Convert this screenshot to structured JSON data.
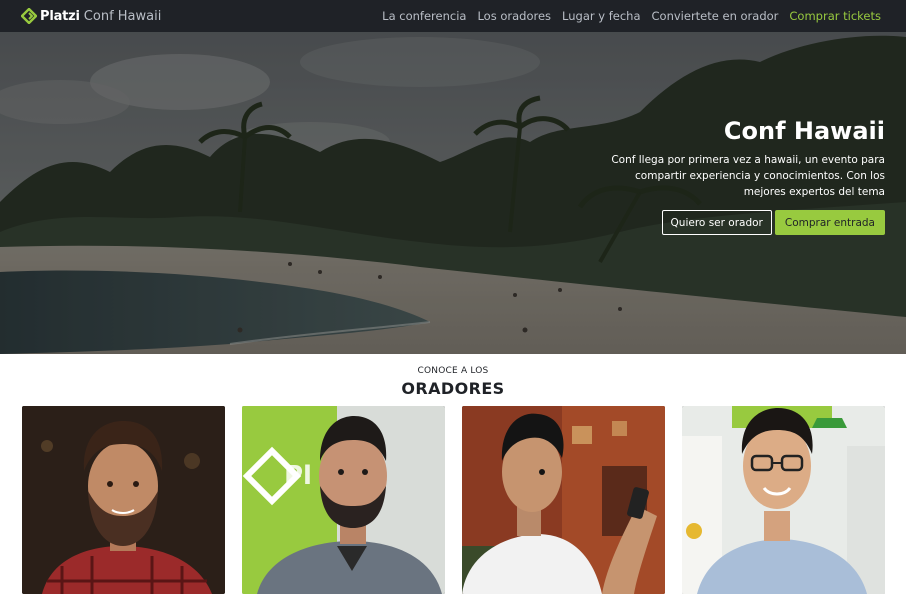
{
  "brand": {
    "logo_text": "Platzi",
    "conf_text": "Conf Hawaii",
    "icon": "platzi-logo-icon",
    "accent_color": "#98ca3f"
  },
  "nav": {
    "links": [
      "La conferencia",
      "Los oradores",
      "Lugar y fecha",
      "Conviertete en orador"
    ],
    "cta": "Comprar tickets"
  },
  "hero": {
    "title": "Conf Hawaii",
    "description": "Conf llega por primera vez a hawaii, un evento para compartir experiencia y conocimientos. Con los mejores expertos del tema",
    "buttons": {
      "secondary": "Quiero ser orador",
      "primary": "Comprar entrada"
    }
  },
  "speakers": {
    "kicker": "CONOCE A LOS",
    "title": "ORADORES",
    "photos": [
      "speaker-photo-1",
      "speaker-photo-2",
      "speaker-photo-3",
      "speaker-photo-4"
    ]
  }
}
